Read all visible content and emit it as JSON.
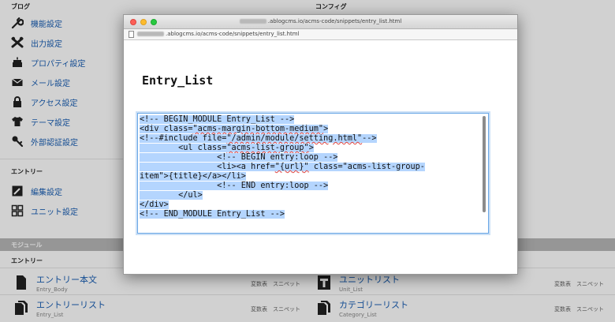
{
  "background": {
    "left": {
      "section_blog": "ブログ",
      "items": [
        {
          "label": "機能設定",
          "icon": "wrench-icon"
        },
        {
          "label": "出力設定",
          "icon": "tools-icon"
        },
        {
          "label": "プロパティ設定",
          "icon": "cake-icon"
        },
        {
          "label": "メール設定",
          "icon": "mail-icon"
        },
        {
          "label": "アクセス設定",
          "icon": "lock-icon"
        },
        {
          "label": "テーマ設定",
          "icon": "shirt-icon"
        },
        {
          "label": "外部認証設定",
          "icon": "key-icon"
        }
      ],
      "section_entry": "エントリー",
      "entry_items": [
        {
          "label": "編集設定",
          "icon": "edit-icon"
        },
        {
          "label": "ユニット設定",
          "icon": "grid-icon"
        }
      ]
    },
    "right": {
      "section_config": "コンフィグ"
    },
    "modules": {
      "bar_label": "モジュール",
      "sub_label": "エントリー",
      "rows": [
        {
          "jp": "エントリー本文",
          "en": "Entry_Body",
          "links": "変数表　スニペット",
          "icon": "doc-icon"
        },
        {
          "jp": "ユニットリスト",
          "en": "Unit_List",
          "links": "変数表　スニペット",
          "icon": "unit-icon"
        },
        {
          "jp": "エントリーリスト",
          "en": "Entry_List",
          "links": "変数表　スニペット",
          "icon": "docs-icon"
        },
        {
          "jp": "カテゴリーリスト",
          "en": "Category_List",
          "links": "変数表　スニペット",
          "icon": "docs-icon"
        }
      ]
    }
  },
  "popup": {
    "title": ".ablogcms.io/acms-code/snippets/entry_list.html",
    "url": ".ablogcms.io/acms-code/snippets/entry_list.html",
    "heading": "Entry_List",
    "code_lines": [
      "<!-- BEGIN_MODULE Entry_List -->",
      "<div class=\"acms-margin-bottom-medium\">",
      "<!--#include file=\"/admin/module/setting.html\"-->",
      "        <ul class=\"acms-list-group\">",
      "                <!-- BEGIN entry:loop -->",
      "                <li><a href=\"{url}\" class=\"acms-list-group-",
      "item\">{title}</a></li>",
      "                <!-- END entry:loop -->",
      "        </ul>",
      "</div>",
      "<!-- END_MODULE Entry_List -->"
    ]
  },
  "colors": {
    "link": "#1a5fb4",
    "selection": "#b4d5fe",
    "focus_border": "#6aa7e6"
  }
}
